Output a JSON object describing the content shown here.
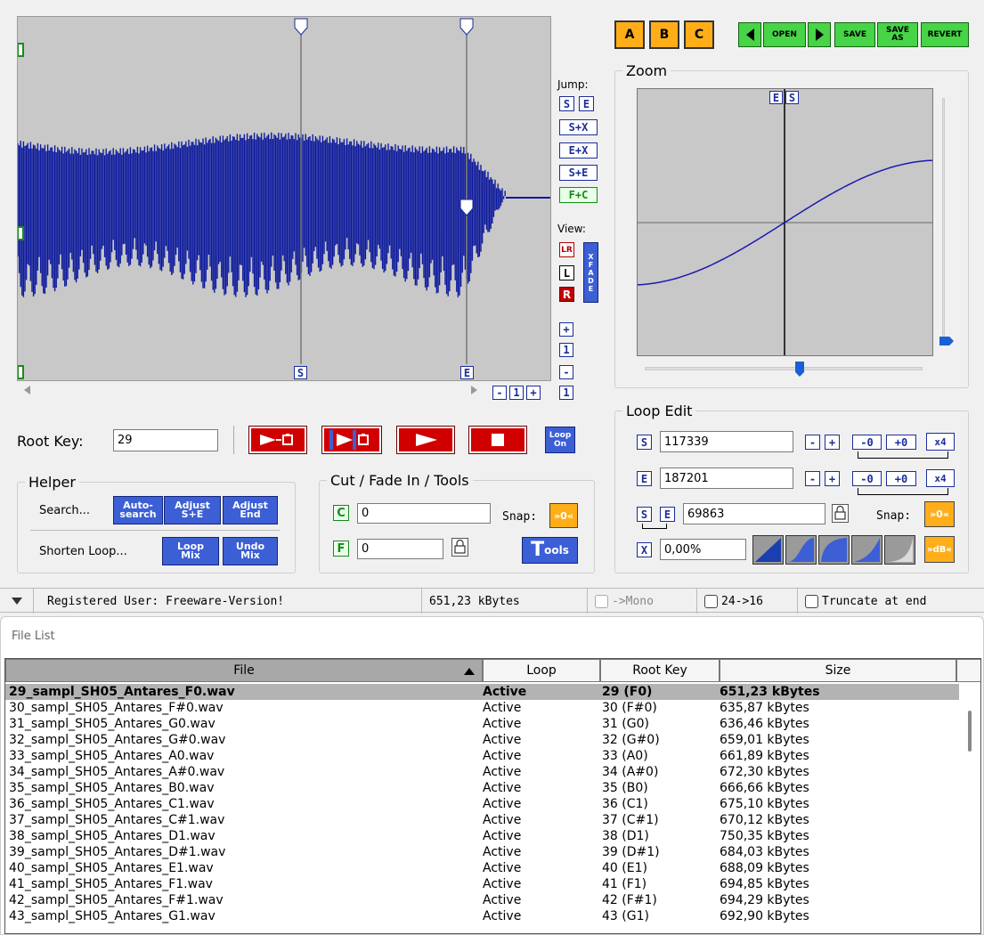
{
  "toolbar": {
    "abc": [
      "A",
      "B",
      "C"
    ],
    "prev_icon": "left-triangle-icon",
    "open": "OPEN",
    "next_icon": "right-triangle-icon",
    "save": "SAVE",
    "save_as": [
      "SAVE",
      "AS"
    ],
    "revert": "REVERT"
  },
  "waveform": {
    "marker_s": "S",
    "marker_e": "E",
    "zoom_buttons": [
      "-",
      "1",
      "+",
      "1"
    ]
  },
  "jump": {
    "label": "Jump:",
    "buttons": [
      "S",
      "E",
      "S+X",
      "E+X",
      "S+E",
      "F+C"
    ]
  },
  "view": {
    "label": "View:",
    "lr": "LR",
    "l": "L",
    "r": "R",
    "xfade": [
      "X",
      "F",
      "A",
      "D",
      "E"
    ],
    "zoom": [
      "+",
      "1",
      "-"
    ]
  },
  "zoom_panel": {
    "title": "Zoom",
    "markers": [
      "E",
      "S"
    ]
  },
  "root": {
    "label": "Root Key:",
    "value": "29"
  },
  "transport": {
    "loop_on": [
      "Loop",
      "On"
    ]
  },
  "helper": {
    "title": "Helper",
    "search_label": "Search...",
    "auto_search": [
      "Auto-",
      "search"
    ],
    "adjust_se": [
      "Adjust",
      "S+E"
    ],
    "adjust_end": [
      "Adjust",
      "End"
    ],
    "shorten_label": "Shorten Loop...",
    "loop_mix": [
      "Loop",
      "Mix"
    ],
    "undo_mix": [
      "Undo",
      "Mix"
    ]
  },
  "cut": {
    "title": "Cut / Fade In / Tools",
    "c_label": "C",
    "c_value": "0",
    "f_label": "F",
    "f_value": "0",
    "snap_label": "Snap:",
    "snap_btn": "»0«",
    "tools": "ools",
    "tools_t": "T"
  },
  "loop_edit": {
    "title": "Loop Edit",
    "s_label": "S",
    "s_value": "117339",
    "e_label": "E",
    "e_value": "187201",
    "len_s": "S",
    "len_e": "E",
    "len_value": "69863",
    "snap_label": "Snap:",
    "snap_btn": "»0«",
    "x_label": "X",
    "x_value": "0,00%",
    "step_buttons": [
      "-",
      "+",
      "-0",
      "+0",
      "x4"
    ],
    "db_btn": "»dB«"
  },
  "status": {
    "user": "Registered User: Freeware-Version!",
    "size": "651,23 kBytes",
    "mono": "->Mono",
    "bits": "24->16",
    "truncate": "Truncate at end"
  },
  "file_list": {
    "title": "File List",
    "columns": [
      "File",
      "Loop",
      "Root Key",
      "Size"
    ],
    "rows": [
      [
        "29_sampl_SH05_Antares_F0.wav",
        "Active",
        "29 (F0)",
        "651,23 kBytes"
      ],
      [
        "30_sampl_SH05_Antares_F#0.wav",
        "Active",
        "30 (F#0)",
        "635,87 kBytes"
      ],
      [
        "31_sampl_SH05_Antares_G0.wav",
        "Active",
        "31 (G0)",
        "636,46 kBytes"
      ],
      [
        "32_sampl_SH05_Antares_G#0.wav",
        "Active",
        "32 (G#0)",
        "659,01 kBytes"
      ],
      [
        "33_sampl_SH05_Antares_A0.wav",
        "Active",
        "33 (A0)",
        "661,89 kBytes"
      ],
      [
        "34_sampl_SH05_Antares_A#0.wav",
        "Active",
        "34 (A#0)",
        "672,30 kBytes"
      ],
      [
        "35_sampl_SH05_Antares_B0.wav",
        "Active",
        "35 (B0)",
        "666,66 kBytes"
      ],
      [
        "36_sampl_SH05_Antares_C1.wav",
        "Active",
        "36 (C1)",
        "675,10 kBytes"
      ],
      [
        "37_sampl_SH05_Antares_C#1.wav",
        "Active",
        "37 (C#1)",
        "670,12 kBytes"
      ],
      [
        "38_sampl_SH05_Antares_D1.wav",
        "Active",
        "38 (D1)",
        "750,35 kBytes"
      ],
      [
        "39_sampl_SH05_Antares_D#1.wav",
        "Active",
        "39 (D#1)",
        "684,03 kBytes"
      ],
      [
        "40_sampl_SH05_Antares_E1.wav",
        "Active",
        "40 (E1)",
        "688,09 kBytes"
      ],
      [
        "41_sampl_SH05_Antares_F1.wav",
        "Active",
        "41 (F1)",
        "694,85 kBytes"
      ],
      [
        "42_sampl_SH05_Antares_F#1.wav",
        "Active",
        "42 (F#1)",
        "694,29 kBytes"
      ],
      [
        "43_sampl_SH05_Antares_G1.wav",
        "Active",
        "43 (G1)",
        "692,90 kBytes"
      ]
    ]
  }
}
